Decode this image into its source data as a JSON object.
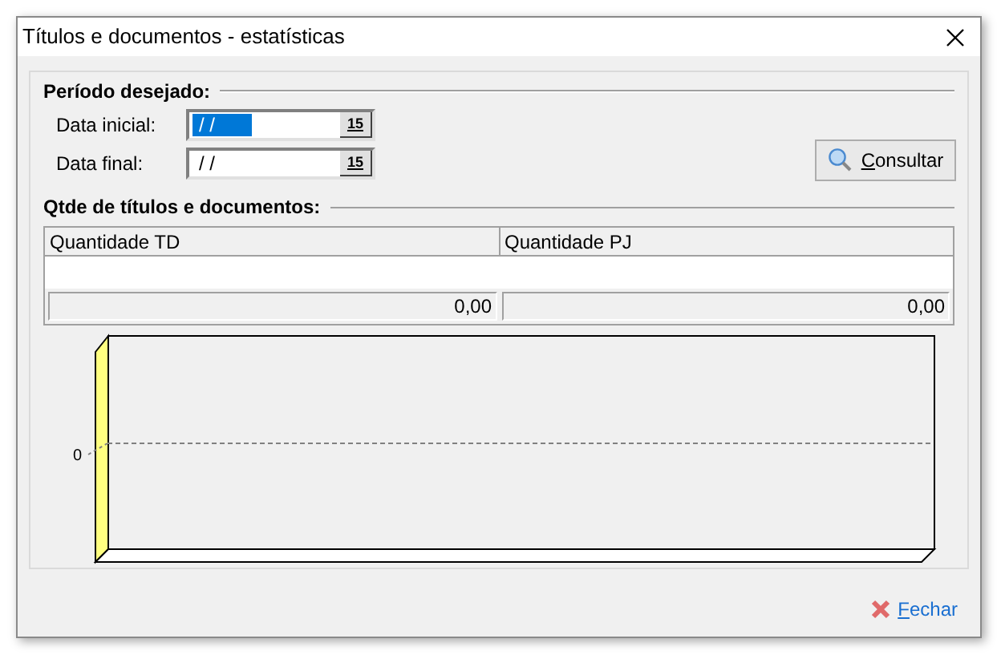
{
  "window": {
    "title": "Títulos e documentos - estatísticas"
  },
  "period": {
    "heading": "Período desejado:",
    "fields": [
      {
        "label": "Data inicial:",
        "value": "/ /",
        "focused": true,
        "calendar_button": "15"
      },
      {
        "label": "Data final:",
        "value": "/ /",
        "focused": false,
        "calendar_button": "15"
      }
    ],
    "search_button": "Consultar"
  },
  "counts": {
    "heading": "Qtde de títulos e documentos:",
    "columns": [
      "Quantidade TD",
      "Quantidade PJ"
    ],
    "totals": [
      "0,00",
      "0,00"
    ]
  },
  "chart": {
    "y_label": "0"
  },
  "close_button": "Fechar"
}
